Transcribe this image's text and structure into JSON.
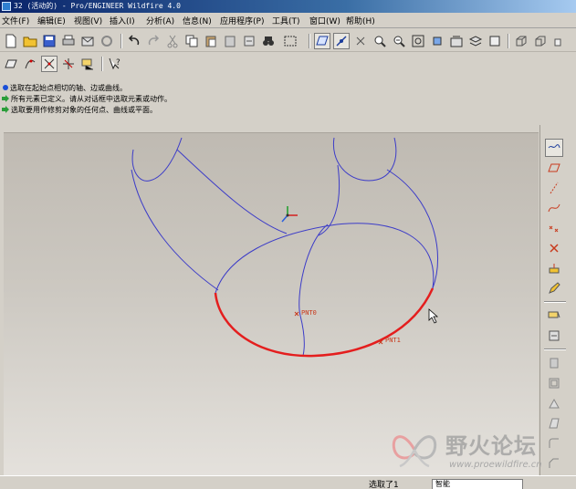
{
  "window": {
    "title": "32 (活动的) - Pro/ENGINEER Wildfire 4.0"
  },
  "menu": [
    "文件(F)",
    "编辑(E)",
    "视图(V)",
    "插入(I)",
    "分析(A)",
    "信息(N)",
    "应用程序(P)",
    "工具(T)",
    "窗口(W)",
    "帮助(H)"
  ],
  "messages": [
    {
      "icon": "blue-dot-icon",
      "text": "选取在起始点相切的轴、边或曲线。"
    },
    {
      "icon": "green-arrow-icon",
      "text": "所有元素已定义。请从对话框中选取元素或动作。"
    },
    {
      "icon": "green-arrow-icon",
      "text": "选取要用作修剪对象的任何点、曲线或平面。"
    }
  ],
  "viewport": {
    "datum_points": [
      "PNT0",
      "PNT1"
    ],
    "colors": {
      "curve": "#3c3cc8",
      "selected_curve": "#e41e1e",
      "point": "#c8391c"
    }
  },
  "status": {
    "selection_text": "选取了1",
    "filter_value": "智能"
  },
  "watermark": {
    "text": "野火论坛",
    "url": "www.proewildfire.cn"
  }
}
